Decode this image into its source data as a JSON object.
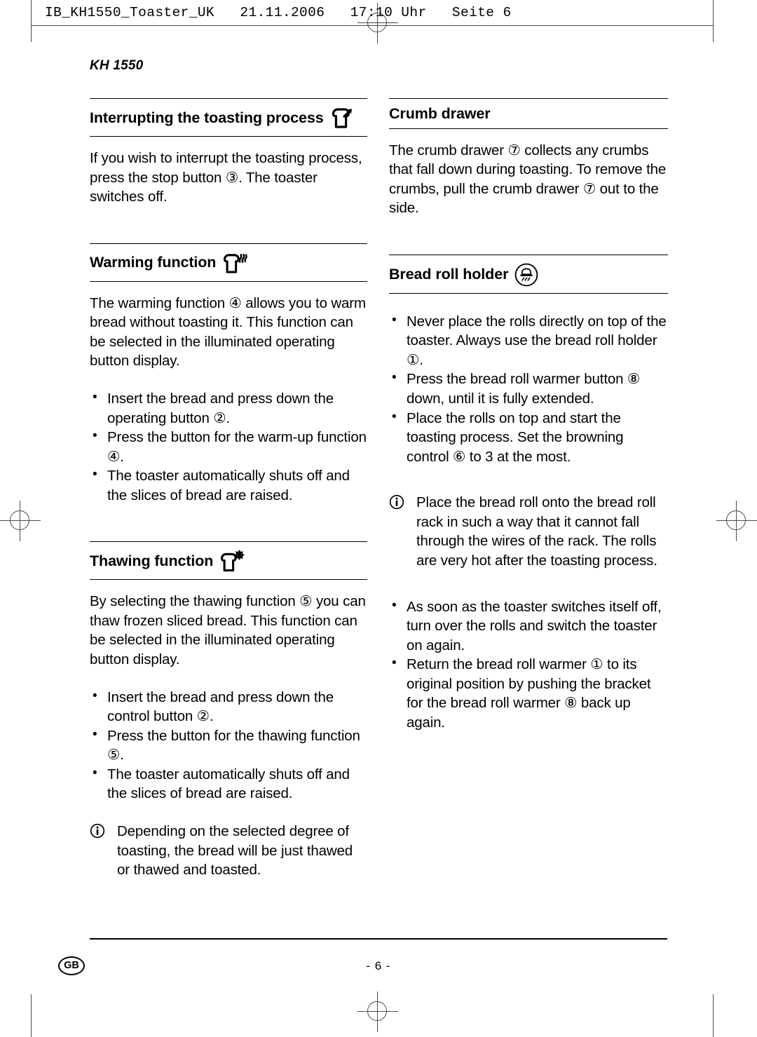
{
  "file_header": {
    "text": "IB_KH1550_Toaster_UK   21.11.2006   17:10 Uhr   Seite 6"
  },
  "model": "KH 1550",
  "left_column": {
    "sections": [
      {
        "id": "interrupting-the-toasting-process",
        "heading": "Interrupting the toasting process",
        "icon": "bread-slice-eject-icon",
        "paragraphs": [
          "If you wish to interrupt the toasting process, press the stop button ③. The toaster switches off."
        ],
        "bullets": [],
        "note": null
      },
      {
        "id": "warming-function",
        "heading": "Warming function",
        "icon": "bread-slice-heat-icon",
        "paragraphs": [
          "The warming function ④ allows you to warm bread without toasting it. This function can be selected in the illuminated operating button display."
        ],
        "bullets": [
          "Insert the bread and press down the operating button ②.",
          "Press the button for the warm-up function ④.",
          "The toaster automatically shuts off and the slices of bread are raised."
        ],
        "note": null
      },
      {
        "id": "thawing-function",
        "heading": "Thawing function",
        "icon": "bread-slice-snowflake-icon",
        "paragraphs": [
          "By selecting the thawing function ⑤ you can thaw frozen sliced bread. This function can be selected in the illuminated operating button display."
        ],
        "bullets": [
          "Insert the bread and press down the control button ②.",
          "Press the button for the thawing function ⑤.",
          "The toaster automatically shuts off and the slices of bread are raised."
        ],
        "note": "Depending on the selected degree of toasting, the bread will be just thawed or thawed and toasted."
      }
    ]
  },
  "right_column": {
    "sections": [
      {
        "id": "crumb-drawer",
        "heading": "Crumb drawer",
        "icon": null,
        "paragraphs": [
          "The crumb drawer ⑦ collects any crumbs that fall down during toasting. To remove the crumbs, pull the crumb drawer ⑦ out to the side."
        ],
        "bullets": [],
        "note": null
      },
      {
        "id": "bread-roll-holder",
        "heading": "Bread roll holder",
        "icon": "bread-roll-warmer-icon",
        "paragraphs": [],
        "bullets": [
          "Never place the rolls directly on top of the toaster. Always use the bread roll holder ①.",
          "Press the bread roll warmer button ⑧ down, until it is fully extended.",
          "Place the rolls on top and start the toasting process. Set the browning control ⑥ to 3 at the most."
        ],
        "note": "Place the bread roll onto the bread roll rack in such a way that it cannot fall through the wires of the rack. The rolls are very hot after the toasting process.",
        "bullets_after": [
          "As soon as the toaster switches itself off, turn over the rolls and switch the toaster on again.",
          "Return the bread roll warmer ① to its original position by pushing the bracket for the bread roll warmer ⑧ back up again."
        ]
      }
    ]
  },
  "footer": {
    "language": "GB",
    "page_number": "- 6 -"
  },
  "colors": {
    "text": "#000000",
    "rule": "#000000",
    "crop_mark": "#4a4a4a",
    "background": "#ffffff"
  }
}
